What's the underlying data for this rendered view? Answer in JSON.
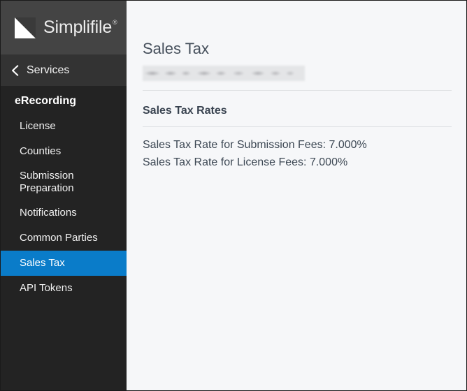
{
  "sidebar": {
    "logo": {
      "mark_icon": "simplifile-triangle-logo-icon",
      "wordmark": "Simplifile",
      "registered_mark": "®"
    },
    "back_nav": {
      "icon": "chevron-left-icon",
      "label": "Services"
    },
    "section_label": "eRecording",
    "items": [
      {
        "label": "License",
        "active": false
      },
      {
        "label": "Counties",
        "active": false
      },
      {
        "label": "Submission Preparation",
        "active": false
      },
      {
        "label": "Notifications",
        "active": false
      },
      {
        "label": "Common Parties",
        "active": false
      },
      {
        "label": "Sales Tax",
        "active": true
      },
      {
        "label": "API Tokens",
        "active": false
      }
    ],
    "active_item_color": "#0a7cc9",
    "header_bg": "#444444",
    "services_bg": "#333333",
    "nav_bg": "#232323"
  },
  "main": {
    "page_title": "Sales Tax",
    "organization_name_redacted": "",
    "section_heading": "Sales Tax Rates",
    "rates": [
      {
        "label": "Sales Tax Rate for Submission Fees",
        "value": "7.000%",
        "text": "Sales Tax Rate for Submission Fees: 7.000%"
      },
      {
        "label": "Sales Tax Rate for License Fees",
        "value": "7.000%",
        "text": "Sales Tax Rate for License Fees: 7.000%"
      }
    ],
    "background": "#f6f7f9"
  }
}
